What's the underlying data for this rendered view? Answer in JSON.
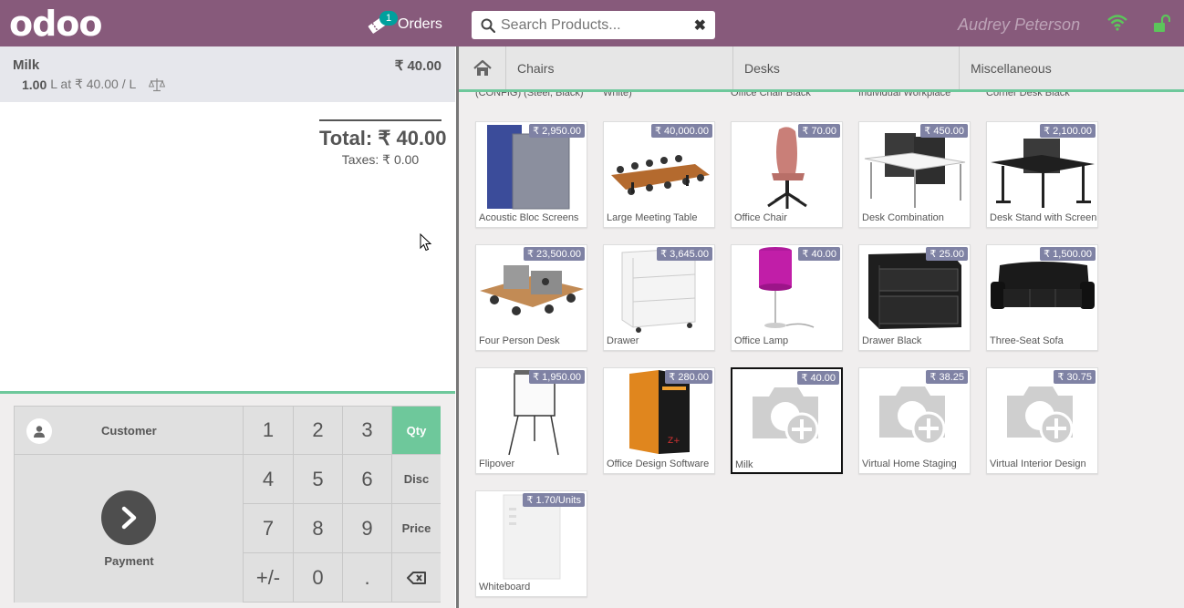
{
  "header": {
    "logo": "odoo",
    "orders_label": "Orders",
    "orders_count": "1",
    "search_placeholder": "Search Products...",
    "clear_icon": "✖",
    "user_name": "Audrey Peterson",
    "wifi_icon": "wifi-icon",
    "lock_icon": "unlock-icon",
    "accent_color": "#875a7b"
  },
  "order": {
    "line": {
      "name": "Milk",
      "price": "₹ 40.00",
      "qty": "1.00",
      "unit_info": "L at ₹ 40.00 / L"
    },
    "total": "Total: ₹ 40.00",
    "taxes": "Taxes: ₹ 0.00"
  },
  "controls": {
    "customer_label": "Customer",
    "payment_label": "Payment",
    "keys": [
      "1",
      "2",
      "3",
      "Qty",
      "4",
      "5",
      "6",
      "Disc",
      "7",
      "8",
      "9",
      "Price",
      "+/-",
      "0",
      ".",
      "⌫"
    ],
    "selected_mode": "Qty",
    "highlight_color": "#6ec89b"
  },
  "categories": [
    "Chairs",
    "Desks",
    "Miscellaneous"
  ],
  "partial_row": [
    "(CONFIG) (Steel, Black)",
    "White)",
    "Office Chair Black",
    "Individual Workplace",
    "Corner Desk Black"
  ],
  "products": [
    {
      "name": "Acoustic Bloc Screens",
      "price": "₹ 2,950.00",
      "icon": "screen-panel"
    },
    {
      "name": "Large Meeting Table",
      "price": "₹ 40,000.00",
      "icon": "meeting-table"
    },
    {
      "name": "Office Chair",
      "price": "₹ 70.00",
      "icon": "chair"
    },
    {
      "name": "Desk Combination",
      "price": "₹ 450.00",
      "icon": "desk-combo"
    },
    {
      "name": "Desk Stand with Screen",
      "price": "₹ 2,100.00",
      "icon": "desk-stand"
    },
    {
      "name": "Four Person Desk",
      "price": "₹ 23,500.00",
      "icon": "four-desk"
    },
    {
      "name": "Drawer",
      "price": "₹ 3,645.00",
      "icon": "drawer-white"
    },
    {
      "name": "Office Lamp",
      "price": "₹ 40.00",
      "icon": "lamp"
    },
    {
      "name": "Drawer Black",
      "price": "₹ 25.00",
      "icon": "drawer-black"
    },
    {
      "name": "Three-Seat Sofa",
      "price": "₹ 1,500.00",
      "icon": "sofa"
    },
    {
      "name": "Flipover",
      "price": "₹ 1,950.00",
      "icon": "flipover"
    },
    {
      "name": "Office Design Software",
      "price": "₹ 280.00",
      "icon": "software-box"
    },
    {
      "name": "Milk",
      "price": "₹ 40.00",
      "icon": "placeholder-camera",
      "selected": true
    },
    {
      "name": "Virtual Home Staging",
      "price": "₹ 38.25",
      "icon": "placeholder-camera"
    },
    {
      "name": "Virtual Interior Design",
      "price": "₹ 30.75",
      "icon": "placeholder-camera"
    },
    {
      "name": "Whiteboard",
      "price": "₹ 1.70/Units",
      "icon": "whiteboard"
    }
  ]
}
